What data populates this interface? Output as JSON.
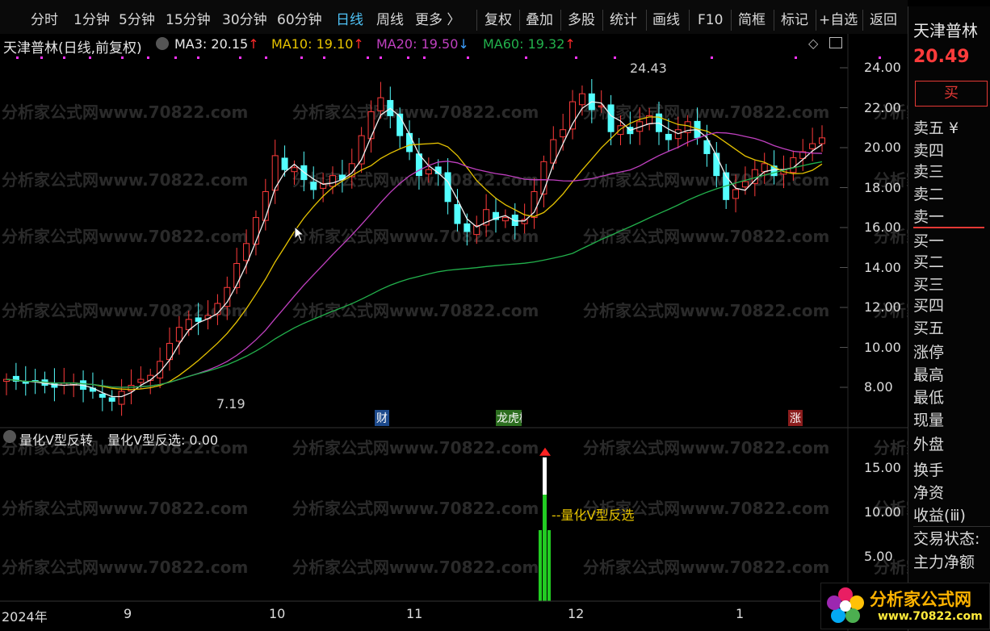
{
  "toolbar": {
    "items": [
      "分时",
      "1分钟",
      "5分钟",
      "15分钟",
      "30分钟",
      "60分钟",
      "日线",
      "周线",
      "更多 〉",
      "复权",
      "叠加",
      "多股",
      "统计",
      "画线",
      "F10",
      "简框",
      "标记",
      "+自选",
      "返回"
    ],
    "active": "日线"
  },
  "stock": {
    "name": "天津普林",
    "price": "20.49",
    "buy_button": "买"
  },
  "main_chart": {
    "title": "天津普林(日线,前复权)",
    "ma": [
      {
        "label": "MA3: 20.15",
        "arrow": "↑",
        "color": "#e8e8e8"
      },
      {
        "label": "MA10: 19.10",
        "arrow": "↑",
        "color": "#e6c300"
      },
      {
        "label": "MA20: 19.50",
        "arrow": "↓",
        "color": "#c040c0"
      },
      {
        "label": "MA60: 19.32",
        "arrow": "↑",
        "color": "#22b14c"
      }
    ],
    "high_label": "24.43",
    "low_label": "7.19",
    "markers": [
      "财",
      "龙虎榜",
      "涨"
    ],
    "y_ticks": [
      "24.00",
      "22.00",
      "20.00",
      "18.00",
      "16.00",
      "14.00",
      "12.00",
      "10.00",
      "8.00"
    ]
  },
  "sub_chart": {
    "title": "量化V型反转",
    "value_label": "量化V型反选: 0.00",
    "annotation": "量化V型反选",
    "y_ticks": [
      "15.00",
      "10.00",
      "5.00"
    ]
  },
  "x_axis": {
    "labels": [
      "2024年",
      "9",
      "10",
      "11",
      "12",
      "1"
    ]
  },
  "watermark": "分析家公式网www.70822.com",
  "right_panel": {
    "items": [
      "卖五 ¥",
      "卖四",
      "卖三",
      "卖二",
      "卖一",
      "买一",
      "买二",
      "买三",
      "买四",
      "买五",
      "涨停",
      "最高",
      "最低",
      "现量",
      "外盘",
      "换手",
      "净资",
      "收益(ⅲ)",
      "交易状态:",
      "主力净额"
    ]
  },
  "logo": {
    "text": "分析家公式网",
    "url": "www.70822.com"
  },
  "chart_data": {
    "type": "candlestick",
    "x": [
      "2024-08",
      "2024-09",
      "2024-10",
      "2024-11",
      "2024-12",
      "2025-01"
    ],
    "close": [
      8.4,
      8.3,
      8.2,
      8.3,
      8.1,
      8.0,
      8.2,
      8.2,
      7.9,
      7.8,
      7.5,
      7.3,
      7.8,
      8.1,
      8.4,
      8.6,
      9.3,
      10.2,
      11.0,
      11.4,
      11.3,
      11.6,
      12.2,
      13.0,
      14.2,
      15.2,
      16.5,
      17.8,
      19.6,
      18.9,
      19.0,
      18.4,
      17.9,
      18.2,
      18.6,
      18.4,
      19.2,
      20.6,
      21.8,
      22.5,
      21.6,
      20.6,
      19.8,
      18.6,
      18.9,
      18.7,
      17.3,
      16.2,
      15.8,
      16.1,
      16.9,
      16.4,
      16.5,
      16.1,
      16.4,
      17.8,
      19.3,
      20.4,
      20.9,
      22.3,
      22.7,
      21.9,
      22.1,
      20.8,
      21.1,
      20.7,
      21.3,
      21.6,
      20.8,
      20.4,
      20.9,
      21.3,
      20.5,
      19.7,
      18.6,
      17.4,
      17.9,
      18.3,
      18.9,
      19.2,
      18.6,
      18.9,
      19.5,
      19.8,
      20.2,
      20.49
    ],
    "ma_series": [
      "MA3",
      "MA10",
      "MA20",
      "MA60"
    ],
    "ylim": [
      7,
      25
    ]
  }
}
